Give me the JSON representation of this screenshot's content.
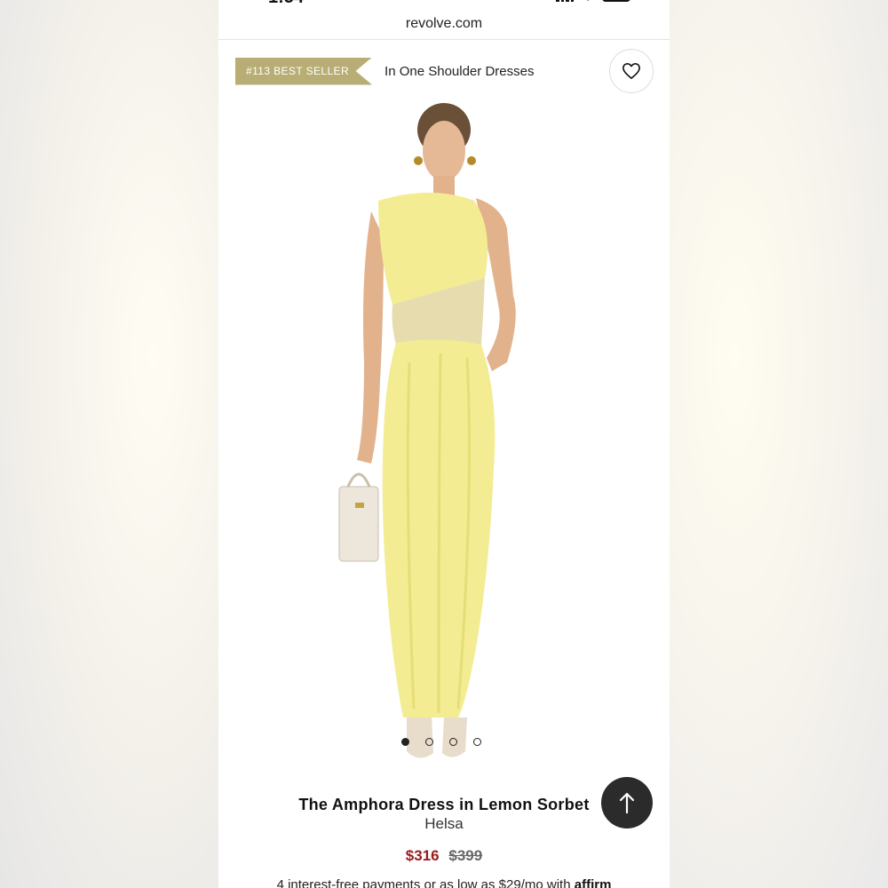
{
  "status_bar": {
    "time": "1:54"
  },
  "browser": {
    "url": "revolve.com"
  },
  "badge": {
    "label": "#113 BEST SELLER",
    "category": "In One Shoulder Dresses"
  },
  "icons": {
    "wishlist": "heart-icon",
    "back_to_top": "arrow-up-icon"
  },
  "gallery": {
    "image_count": 4,
    "active_index": 0
  },
  "product": {
    "title": "The Amphora Dress in Lemon Sorbet",
    "brand": "Helsa",
    "price_sale": "$316",
    "price_original": "$399",
    "installments_text": "4 interest-free payments or as low as $29/mo with",
    "installments_provider": "affirm"
  },
  "colors": {
    "badge_gold": "#b8ad74",
    "sale_red": "#9b1b1b",
    "dress_yellow": "#f3ec93"
  }
}
